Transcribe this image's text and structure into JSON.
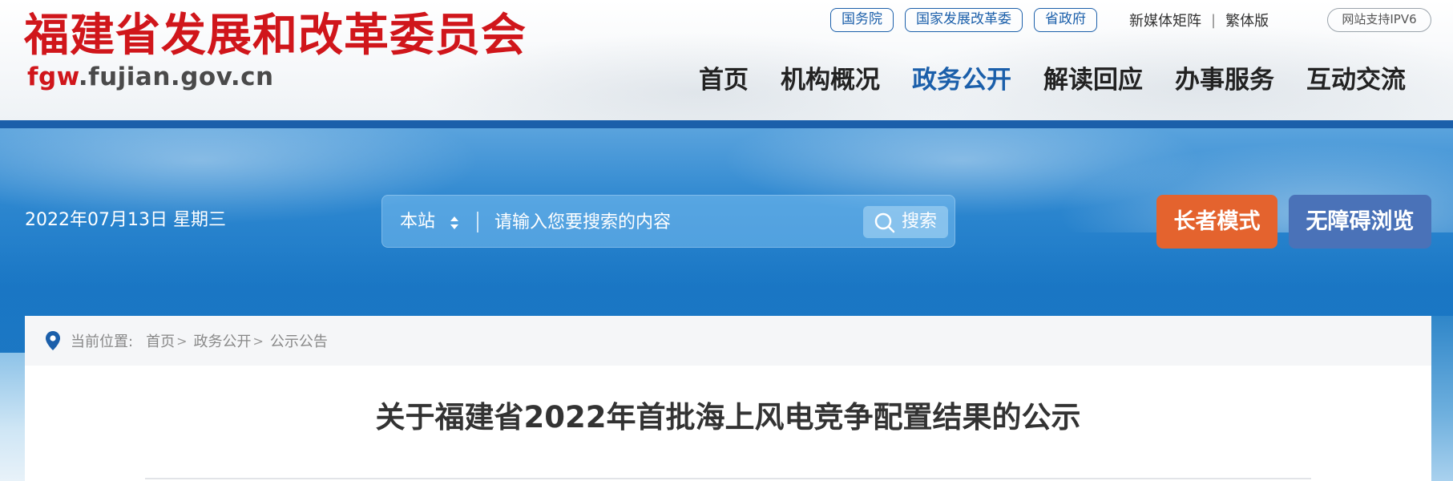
{
  "header": {
    "logo_cn": "福建省发展和改革委员会",
    "logo_en_prefix": "fgw",
    "logo_en_suffix": ".fujian.gov.cn",
    "top_links": [
      "国务院",
      "国家发展改革委",
      "省政府"
    ],
    "media_link": "新媒体矩阵",
    "separator": "|",
    "traditional_link": "繁体版",
    "ipv6_badge": "网站支持IPV6",
    "nav": [
      {
        "label": "首页",
        "active": false
      },
      {
        "label": "机构概况",
        "active": false
      },
      {
        "label": "政务公开",
        "active": true
      },
      {
        "label": "解读回应",
        "active": false
      },
      {
        "label": "办事服务",
        "active": false
      },
      {
        "label": "互动交流",
        "active": false
      }
    ]
  },
  "banner": {
    "date": "2022年07月13日 星期三",
    "search": {
      "scope": "本站",
      "placeholder": "请输入您要搜索的内容",
      "button_label": "搜索"
    },
    "elder_mode": "长者模式",
    "accessible_browse": "无障碍浏览"
  },
  "breadcrumb": {
    "label": "当前位置:",
    "items": [
      "首页",
      "政务公开",
      "公示公告"
    ],
    "gt": ">"
  },
  "article": {
    "title": "关于福建省2022年首批海上风电竞争配置结果的公示"
  },
  "colors": {
    "brand_red": "#d0161b",
    "brand_blue": "#1b5faa",
    "elder_orange": "#e4632e",
    "access_blue": "#4a72b8"
  },
  "icons": {
    "search": "search-icon",
    "location": "location-pin-icon",
    "sort": "sort-arrows-icon"
  }
}
